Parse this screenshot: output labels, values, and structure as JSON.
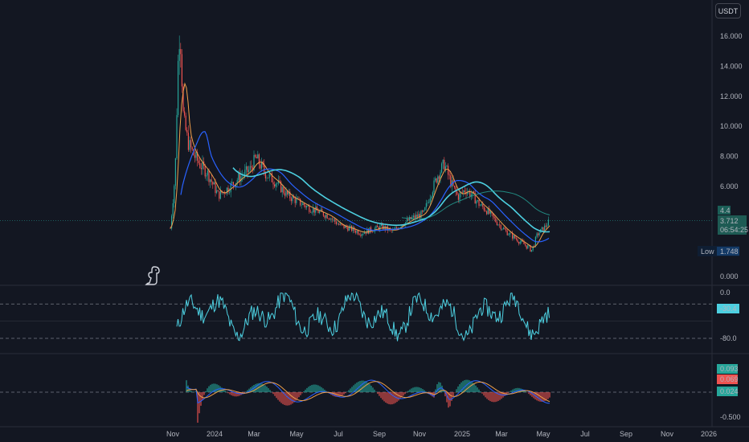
{
  "currency": "USDT",
  "chart_data": {
    "type": "line",
    "x_ticks": [
      "Nov",
      "2024",
      "Mar",
      "May",
      "Jul",
      "Sep",
      "Nov",
      "2025",
      "Mar",
      "May",
      "Jul",
      "Sep",
      "Nov",
      "2026"
    ],
    "price_panel": {
      "y_ticks": [
        "16.000",
        "14.000",
        "12.000",
        "10.000",
        "8.000",
        "6.000",
        "0.000"
      ],
      "price_tag": "4.4",
      "last_price": "3.712",
      "countdown": "06:54:25",
      "low_label": "Low",
      "low_value": "1.748",
      "candle_up_color": "#26a69a",
      "candle_down_color": "#ef5350",
      "series": [
        {
          "color": "#f0a04b",
          "role": "ma-short"
        },
        {
          "color": "#2962ff",
          "role": "ma-mid"
        },
        {
          "color": "#4dd0e1",
          "role": "ma-long"
        },
        {
          "color": "#26a69a",
          "role": "ma-200"
        }
      ],
      "points": [
        [
          "2023-11-01",
          3.2
        ],
        [
          "2023-11-08",
          6.8
        ],
        [
          "2023-11-12",
          14.0
        ],
        [
          "2023-11-15",
          16.8
        ],
        [
          "2023-11-20",
          10.5
        ],
        [
          "2023-11-27",
          8.9
        ],
        [
          "2023-12-05",
          8.1
        ],
        [
          "2023-12-15",
          7.4
        ],
        [
          "2023-12-25",
          6.9
        ],
        [
          "2024-01-10",
          5.4
        ],
        [
          "2024-01-25",
          5.9
        ],
        [
          "2024-02-10",
          6.6
        ],
        [
          "2024-02-25",
          7.1
        ],
        [
          "2024-03-05",
          7.9
        ],
        [
          "2024-03-20",
          6.8
        ],
        [
          "2024-04-05",
          6.2
        ],
        [
          "2024-04-20",
          5.4
        ],
        [
          "2024-05-05",
          5.0
        ],
        [
          "2024-05-20",
          4.6
        ],
        [
          "2024-06-05",
          4.3
        ],
        [
          "2024-06-20",
          4.0
        ],
        [
          "2024-07-05",
          3.4
        ],
        [
          "2024-07-20",
          3.2
        ],
        [
          "2024-08-05",
          2.9
        ],
        [
          "2024-08-20",
          3.1
        ],
        [
          "2024-09-05",
          3.3
        ],
        [
          "2024-09-20",
          3.0
        ],
        [
          "2024-10-05",
          3.5
        ],
        [
          "2024-10-20",
          3.9
        ],
        [
          "2024-11-05",
          4.2
        ],
        [
          "2024-11-15",
          5.5
        ],
        [
          "2024-11-25",
          6.7
        ],
        [
          "2024-12-05",
          7.5
        ],
        [
          "2024-12-15",
          6.2
        ],
        [
          "2024-12-25",
          5.3
        ],
        [
          "2025-01-05",
          5.8
        ],
        [
          "2025-01-15",
          5.4
        ],
        [
          "2025-01-25",
          4.8
        ],
        [
          "2025-02-05",
          4.4
        ],
        [
          "2025-02-20",
          3.6
        ],
        [
          "2025-03-05",
          3.0
        ],
        [
          "2025-03-20",
          2.5
        ],
        [
          "2025-04-05",
          2.0
        ],
        [
          "2025-04-12",
          1.75
        ],
        [
          "2025-04-20",
          2.8
        ],
        [
          "2025-05-01",
          3.3
        ],
        [
          "2025-05-08",
          3.712
        ]
      ]
    },
    "oscillator_panel": {
      "y_ticks": [
        "0.0",
        "-80.0"
      ],
      "value_tag": "-30.4",
      "line_color": "#4dd0e1"
    },
    "macd_panel": {
      "y_ticks": [
        "-0.500"
      ],
      "value_tags": [
        "0.093",
        "0.069",
        "0.024"
      ],
      "tag_colors": [
        "#26a69a",
        "#ef5350",
        "#26a69a"
      ],
      "macd_color": "#2962ff",
      "signal_color": "#f0a04b"
    }
  }
}
